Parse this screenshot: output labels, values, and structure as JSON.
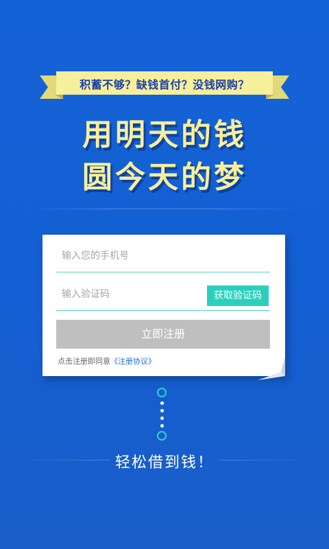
{
  "banner": {
    "ribbon_text": "积蓄不够？缺钱首付？没钱网购？",
    "headline_line1": "用明天的钱",
    "headline_line2": "圆今天的梦"
  },
  "form": {
    "phone_placeholder": "输入您的手机号",
    "code_placeholder": "输入验证码",
    "get_code_label": "获取验证码",
    "register_label": "立即注册",
    "agree_prefix": "点击注册即同意",
    "agreement_link": "《注册协议》"
  },
  "footer": {
    "tagline": "轻松借到钱！"
  },
  "colors": {
    "background": "#1463d6",
    "ribbon": "#f6ef9b",
    "headline": "#f8ef9a",
    "accent": "#2bcfbd",
    "register_button": "#bfbfbf",
    "link": "#1e6fd8"
  },
  "icons": {
    "step_start": "ring-icon",
    "step_end": "ring-icon"
  }
}
